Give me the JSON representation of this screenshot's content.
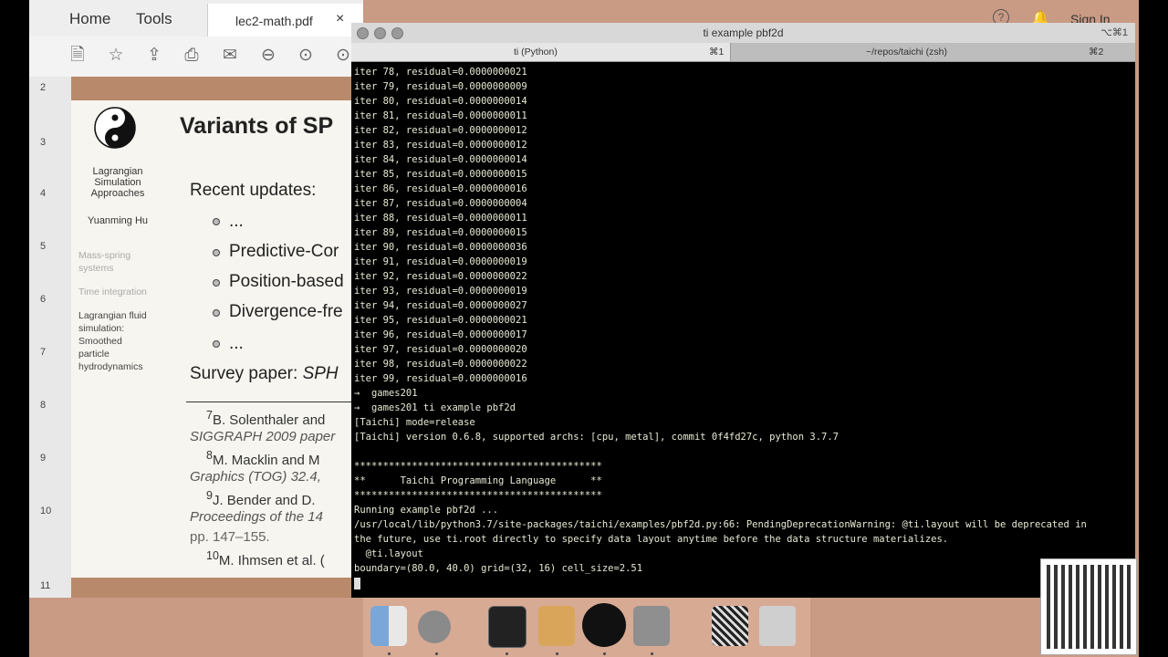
{
  "pdf": {
    "nav": {
      "home": "Home",
      "tools": "Tools"
    },
    "tab_name": "lec2-math.pdf",
    "close": "×",
    "sign_in": "Sign In",
    "help_icon": "?",
    "page_numbers": [
      "2",
      "3",
      "4",
      "5",
      "6",
      "7",
      "8",
      "9",
      "10",
      "11"
    ],
    "slide": {
      "title": "Variants of SP",
      "sidebar_title": [
        "Lagrangian",
        "Simulation",
        "Approaches"
      ],
      "author": "Yuanming Hu",
      "sidebar_items": [
        "Mass-spring",
        "systems",
        "Time integration"
      ],
      "sidebar_current": [
        "Lagrangian fluid",
        "simulation:",
        "Smoothed",
        "particle",
        "hydrodynamics"
      ],
      "recent": "Recent updates:",
      "bullets": [
        "...",
        "Predictive-Cor",
        "Position-based",
        "Divergence-fre",
        "..."
      ],
      "survey_label": "Survey paper:",
      "survey_val": "SPH",
      "footnotes": [
        {
          "num": "7",
          "text": "B. Solenthaler and"
        },
        {
          "it": "SIGGRAPH 2009 paper"
        },
        {
          "num": "8",
          "text": "M. Macklin and M"
        },
        {
          "it": "Graphics (TOG) 32.4,"
        },
        {
          "num": "9",
          "text": "J. Bender and D."
        },
        {
          "it": "Proceedings of the 14"
        },
        {
          "text": "pp. 147–155."
        },
        {
          "num": "10",
          "text": "M. Ihmsen et al. ("
        }
      ]
    }
  },
  "terminal": {
    "title": "ti example pbf2d",
    "shortcut": "⌥⌘1",
    "tabs": [
      {
        "label": "ti (Python)",
        "key": "⌘1"
      },
      {
        "label": "~/repos/taichi (zsh)",
        "key": "⌘2"
      }
    ],
    "lines": [
      "iter 78, residual=0.0000000021",
      "iter 79, residual=0.0000000009",
      "iter 80, residual=0.0000000014",
      "iter 81, residual=0.0000000011",
      "iter 82, residual=0.0000000012",
      "iter 83, residual=0.0000000012",
      "iter 84, residual=0.0000000014",
      "iter 85, residual=0.0000000015",
      "iter 86, residual=0.0000000016",
      "iter 87, residual=0.0000000004",
      "iter 88, residual=0.0000000011",
      "iter 89, residual=0.0000000015",
      "iter 90, residual=0.0000000036",
      "iter 91, residual=0.0000000019",
      "iter 92, residual=0.0000000022",
      "iter 93, residual=0.0000000019",
      "iter 94, residual=0.0000000027",
      "iter 95, residual=0.0000000021",
      "iter 96, residual=0.0000000017",
      "iter 97, residual=0.0000000020",
      "iter 98, residual=0.0000000022",
      "iter 99, residual=0.0000000016",
      "→  games201",
      "→  games201 ti example pbf2d",
      "[Taichi] mode=release",
      "[Taichi] version 0.6.8, supported archs: [cpu, metal], commit 0f4fd27c, python 3.7.7",
      "",
      "*******************************************",
      "**      Taichi Programming Language      **",
      "*******************************************",
      "Running example pbf2d ...",
      "/usr/local/lib/python3.7/site-packages/taichi/examples/pbf2d.py:66: PendingDeprecationWarning: @ti.layout will be deprecated in",
      "the future, use ti.root directly to specify data layout anytime before the data structure materializes.",
      "  @ti.layout",
      "boundary=(80.0, 40.0) grid=(32, 16) cell_size=2.51"
    ]
  },
  "dock": {
    "apps": [
      "finder-icon",
      "launchpad-icon",
      "terminal-icon",
      "keynote-icon",
      "obs-icon",
      "acrobat-icon",
      "qr-app-icon",
      "trash-icon"
    ]
  }
}
